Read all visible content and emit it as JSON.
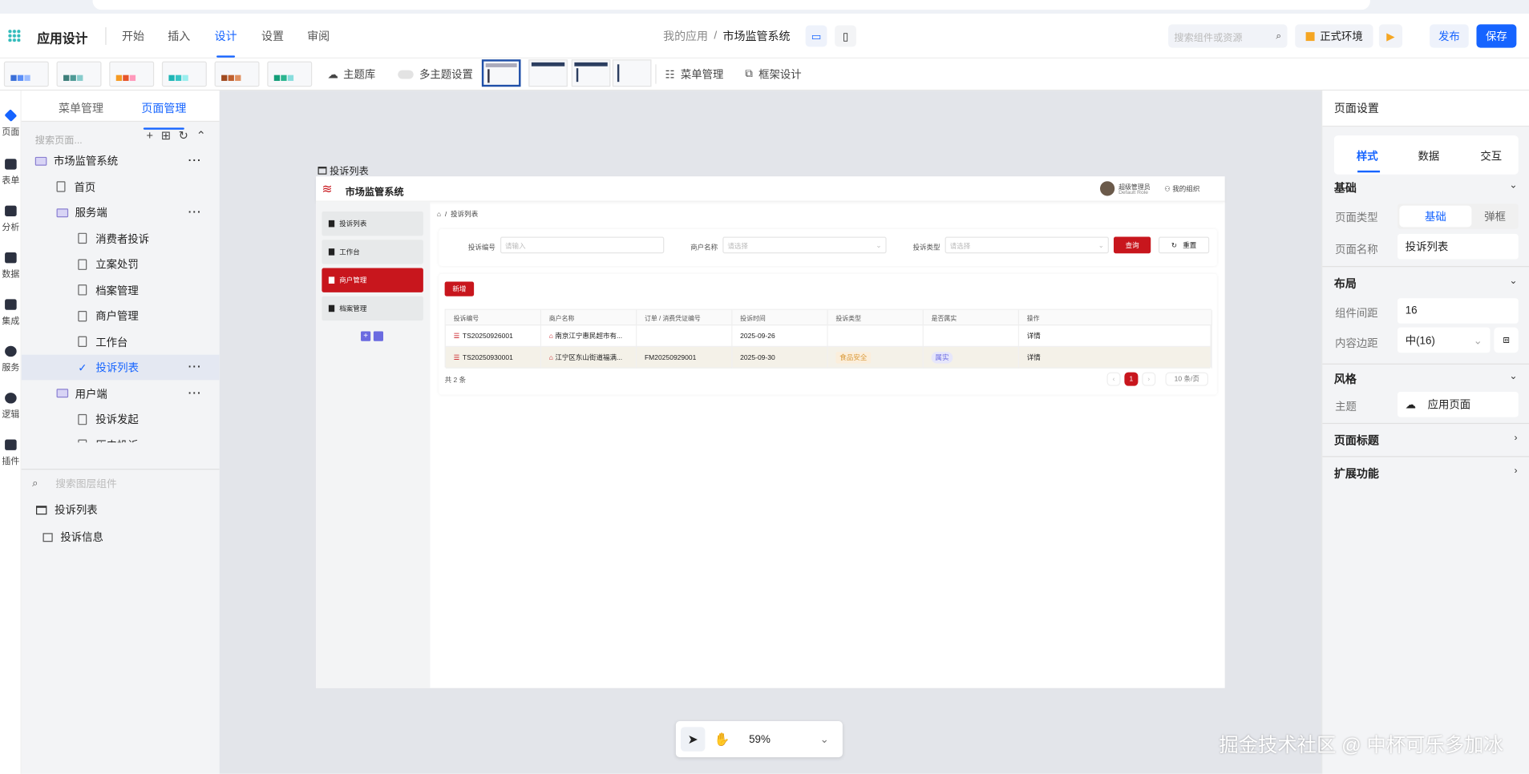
{
  "header": {
    "app_title": "应用设计",
    "tabs": [
      "开始",
      "插入",
      "设计",
      "设置",
      "审阅"
    ],
    "active_tab": "设计",
    "breadcrumb_root": "我的应用",
    "breadcrumb_sep": "/",
    "breadcrumb_current": "市场监管系统",
    "search_placeholder": "搜索组件或资源",
    "env_label": "正式环境",
    "publish": "发布",
    "save": "保存"
  },
  "toolbar": {
    "theme_lib": "主题库",
    "multi_theme": "多主题设置",
    "menu_manage": "菜单管理",
    "frame_design": "框架设计",
    "swatch_colors": [
      "#5b8ff9",
      "#4e9a96",
      "#f59a23",
      "#36c5c5",
      "#c0602e",
      "#2bb58f"
    ]
  },
  "rail": [
    "页面",
    "表单",
    "分析",
    "数据",
    "集成",
    "服务",
    "逻辑",
    "插件"
  ],
  "left_panel": {
    "tabs": [
      "菜单管理",
      "页面管理"
    ],
    "active_tab": "页面管理",
    "search_placeholder": "搜索页面...",
    "tree": [
      {
        "label": "市场监管系统",
        "type": "folder",
        "level": 0,
        "more": "···"
      },
      {
        "label": "首页",
        "type": "page",
        "level": 1
      },
      {
        "label": "服务端",
        "type": "folder",
        "level": 1,
        "more": "···"
      },
      {
        "label": "消费者投诉",
        "type": "page",
        "level": 2
      },
      {
        "label": "立案处罚",
        "type": "page",
        "level": 2
      },
      {
        "label": "档案管理",
        "type": "page",
        "level": 2
      },
      {
        "label": "商户管理",
        "type": "page",
        "level": 2
      },
      {
        "label": "工作台",
        "type": "page",
        "level": 2
      },
      {
        "label": "投诉列表",
        "type": "selected",
        "level": 2,
        "more": "···"
      },
      {
        "label": "用户端",
        "type": "folder",
        "level": 1,
        "more": "···"
      },
      {
        "label": "投诉发起",
        "type": "page",
        "level": 2
      },
      {
        "label": "历史投诉",
        "type": "page",
        "level": 2
      }
    ],
    "layer_search_placeholder": "搜索图层组件",
    "layers": [
      "投诉列表",
      "投诉信息"
    ]
  },
  "preview": {
    "frame_label": "投诉列表",
    "app_name": "市场监管系统",
    "user_name": "超级管理员",
    "user_role": "Default Role",
    "org": "我的组织",
    "menu": [
      "投诉列表",
      "工作台",
      "商户管理",
      "档案管理"
    ],
    "active_menu": "商户管理",
    "breadcrumb": "投诉列表",
    "filters": [
      {
        "label": "投诉编号",
        "placeholder": "请输入"
      },
      {
        "label": "商户名称",
        "placeholder": "请选择"
      },
      {
        "label": "投诉类型",
        "placeholder": "请选择"
      }
    ],
    "query": "查询",
    "reset": "重置",
    "add": "新增",
    "columns": [
      "投诉编号",
      "商户名称",
      "订单 / 消费凭证编号",
      "投诉时间",
      "投诉类型",
      "是否属实",
      "操作"
    ],
    "rows": [
      [
        "TS20250926001",
        "南京江宁惠民超市有...",
        "",
        "2025-09-26",
        "",
        "",
        "详情"
      ],
      [
        "TS20250930001",
        "江宁区东山街道福满...",
        "FM20250929001",
        "2025-09-30",
        "食品安全",
        "属实",
        "详情"
      ]
    ],
    "total": "共 2 条",
    "page": "1",
    "page_size": "10 条/页"
  },
  "right_panel": {
    "title": "页面设置",
    "tabs": [
      "样式",
      "数据",
      "交互"
    ],
    "active_tab": "样式",
    "basic": "基础",
    "page_type_label": "页面类型",
    "page_type_options": [
      "基础",
      "弹框"
    ],
    "page_name_label": "页面名称",
    "page_name": "投诉列表",
    "layout": "布局",
    "gap_label": "组件间距",
    "gap": "16",
    "padding_label": "内容边距",
    "padding": "中(16)",
    "style": "风格",
    "theme_label": "主题",
    "theme": "应用页面",
    "page_title": "页面标题",
    "extensions": "扩展功能"
  },
  "zoom": {
    "value": "59%"
  },
  "watermark": "掘金技术社区 @ 中杯可乐多加冰"
}
